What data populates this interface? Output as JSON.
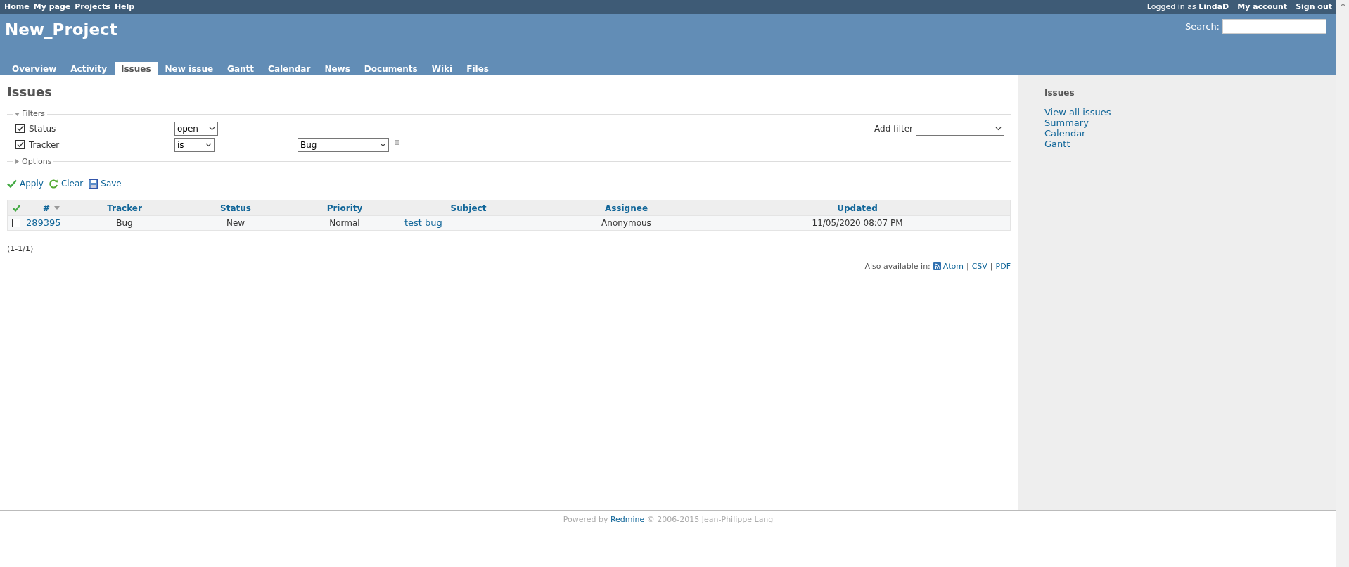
{
  "top_menu": [
    "Home",
    "My page",
    "Projects",
    "Help"
  ],
  "account": {
    "logged_in_label": "Logged in as",
    "user": "LindaD",
    "links": [
      "My account",
      "Sign out"
    ]
  },
  "project_title": "New_Project",
  "search": {
    "label": "Search:"
  },
  "tabs": [
    {
      "label": "Overview",
      "selected": false
    },
    {
      "label": "Activity",
      "selected": false
    },
    {
      "label": "Issues",
      "selected": true
    },
    {
      "label": "New issue",
      "selected": false
    },
    {
      "label": "Gantt",
      "selected": false
    },
    {
      "label": "Calendar",
      "selected": false
    },
    {
      "label": "News",
      "selected": false
    },
    {
      "label": "Documents",
      "selected": false
    },
    {
      "label": "Wiki",
      "selected": false
    },
    {
      "label": "Files",
      "selected": false
    }
  ],
  "page_title": "Issues",
  "filters": {
    "legend": "Filters",
    "expanded": true,
    "rows": [
      {
        "label": "Status",
        "checked": true,
        "operator": "open"
      },
      {
        "label": "Tracker",
        "checked": true,
        "operator": "is",
        "value": "Bug"
      }
    ],
    "add_filter_label": "Add filter"
  },
  "options": {
    "legend": "Options",
    "expanded": false
  },
  "actions": [
    {
      "kind": "apply",
      "label": "Apply"
    },
    {
      "kind": "clear",
      "label": "Clear"
    },
    {
      "kind": "save",
      "label": "Save"
    }
  ],
  "table": {
    "columns": [
      {
        "label": "#",
        "sorted": true
      },
      {
        "label": "Tracker",
        "sorted": false
      },
      {
        "label": "Status",
        "sorted": false
      },
      {
        "label": "Priority",
        "sorted": false
      },
      {
        "label": "Subject",
        "sorted": false
      },
      {
        "label": "Assignee",
        "sorted": false
      },
      {
        "label": "Updated",
        "sorted": false
      }
    ],
    "rows": [
      {
        "checked": false,
        "cells": [
          {
            "text": "289395",
            "link": true
          },
          {
            "text": "Bug",
            "link": false
          },
          {
            "text": "New",
            "link": false
          },
          {
            "text": "Normal",
            "link": false
          },
          {
            "text": "test bug",
            "link": true
          },
          {
            "text": "Anonymous",
            "link": false
          },
          {
            "text": "11/05/2020 08:07 PM",
            "link": false
          }
        ]
      }
    ]
  },
  "count": "(1-1/1)",
  "export": {
    "label": "Also available in:",
    "links": [
      {
        "kind": "feed",
        "label": "Atom"
      },
      {
        "kind": "separator",
        "label": "|"
      },
      {
        "kind": "plain",
        "label": "CSV"
      },
      {
        "kind": "separator",
        "label": "|"
      },
      {
        "kind": "plain",
        "label": "PDF"
      }
    ]
  },
  "sidebar": {
    "title": "Issues",
    "links": [
      "View all issues",
      "Summary",
      "Calendar",
      "Gantt"
    ]
  },
  "footer": {
    "prefix": "Powered by",
    "link": "Redmine",
    "suffix": "© 2006-2015 Jean-Philippe Lang"
  }
}
